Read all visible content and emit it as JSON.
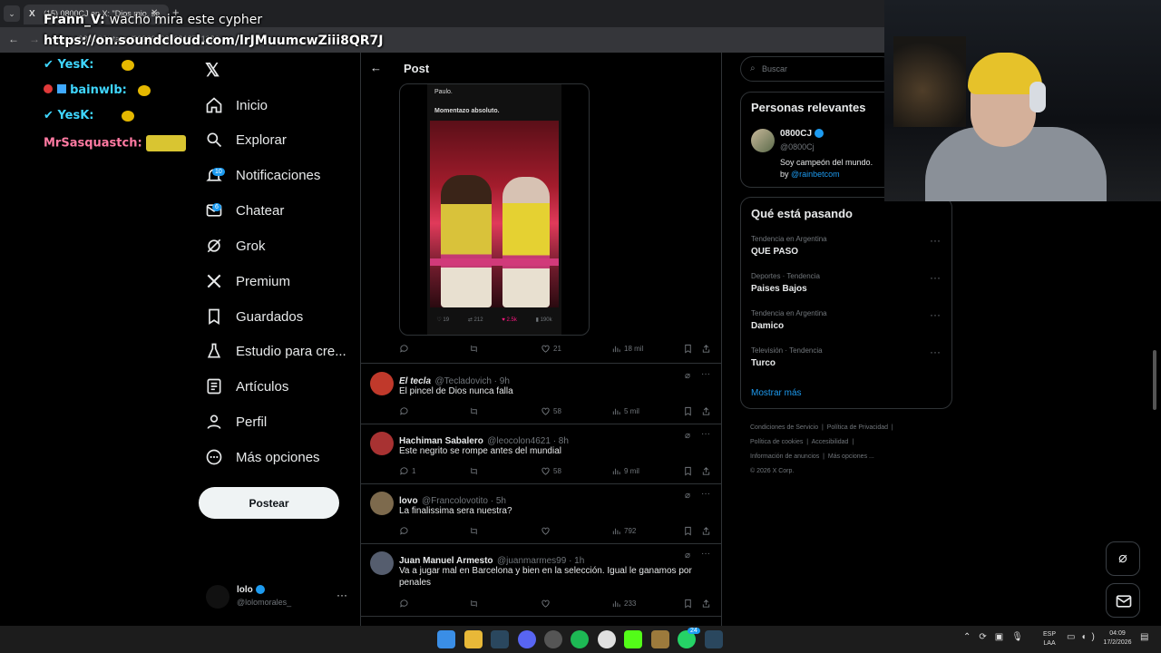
{
  "browser": {
    "tab_title": "(15) 0800CJ en X: \"Dios mio, se",
    "url": "x.com/0800CJ/status/2023612909918771286",
    "overlay_url": "https://on.soundcloud.com/lrJMuumcwZiii8QR7J"
  },
  "stream_chat": [
    {
      "user": "Frann_V:",
      "message": "wacho mira este cypher",
      "color": "#ffffff"
    },
    {
      "user": "YesK:",
      "message": "",
      "color": "#3fd6ff"
    },
    {
      "user": "bainwlb:",
      "message": "",
      "color": "#3fd6ff"
    },
    {
      "user": "YesK:",
      "message": "",
      "color": "#3fd6ff"
    },
    {
      "user": "MrSasquastch:",
      "message": "",
      "color": "#ff7aa2"
    }
  ],
  "nav": {
    "items": [
      {
        "label": "Inicio",
        "icon": "home-icon"
      },
      {
        "label": "Explorar",
        "icon": "search-icon"
      },
      {
        "label": "Notificaciones",
        "icon": "bell-icon",
        "badge": "10"
      },
      {
        "label": "Chatear",
        "icon": "mail-icon",
        "badge": "6"
      },
      {
        "label": "Grok",
        "icon": "grok-icon"
      },
      {
        "label": "Premium",
        "icon": "x-logo-icon"
      },
      {
        "label": "Guardados",
        "icon": "bookmark-icon"
      },
      {
        "label": "Estudio para cre...",
        "icon": "flask-icon"
      },
      {
        "label": "Artículos",
        "icon": "article-icon"
      },
      {
        "label": "Perfil",
        "icon": "person-icon"
      },
      {
        "label": "Más opciones",
        "icon": "more-circle-icon"
      }
    ],
    "post_label": "Postear",
    "account": {
      "name": "lolo",
      "handle": "@lolomorales_"
    }
  },
  "header": {
    "title": "Post"
  },
  "embedded": {
    "text_line1": "Paulo.",
    "text_line2": "Momentazo absoluto.",
    "stats": {
      "replies": "19",
      "reposts": "212",
      "likes": "2.5k",
      "views": "190k"
    }
  },
  "main_actions": {
    "likes": "21",
    "views": "18 mil"
  },
  "replies": [
    {
      "name": "El tecla",
      "handle": "@Tecladovich · 9h",
      "text": "El pincel de Dios nunca falla",
      "replies": "",
      "likes": "58",
      "views": "5 mil",
      "avatar_color": "#c0392b"
    },
    {
      "name": "Hachiman Sabalero",
      "handle": "@leocolon4621 · 8h",
      "text": "Este negrito se rompe antes del mundial",
      "replies": "1",
      "likes": "58",
      "views": "9 mil",
      "avatar_color": "#a83232"
    },
    {
      "name": "lovo",
      "handle": "@Francolovotito · 5h",
      "text": "La finalissima sera nuestra?",
      "replies": "",
      "likes": "",
      "views": "792",
      "avatar_color": "#7d6a4d"
    },
    {
      "name": "Juan Manuel Armesto",
      "handle": "@juanmarmes99 · 1h",
      "text": "Va a jugar mal en Barcelona y bien en la selección. Igual le ganamos por penales",
      "replies": "",
      "likes": "",
      "views": "233",
      "avatar_color": "#555d6e"
    }
  ],
  "right": {
    "search_placeholder": "Buscar",
    "relevant_title": "Personas relevantes",
    "relevant_user": {
      "name": "0800CJ",
      "handle": "@0800Cj",
      "bio": "Soy campeón del mundo.",
      "bio_by": "by ",
      "bio_link": "@rainbetcom"
    },
    "trends_title": "Qué está pasando",
    "trends": [
      {
        "meta": "Tendencia en Argentina",
        "name": "QUE PASO"
      },
      {
        "meta": "Deportes · Tendencia",
        "name": "Paises Bajos"
      },
      {
        "meta": "Tendencia en Argentina",
        "name": "Damico"
      },
      {
        "meta": "Televisión · Tendencia",
        "name": "Turco"
      }
    ],
    "show_more": "Mostrar más",
    "footer": [
      "Condiciones de Servicio",
      "Política de Privacidad",
      "Política de cookies",
      "Accesibilidad",
      "Información de anuncios",
      "Más opciones ...",
      "© 2026 X Corp."
    ]
  },
  "taskbar": {
    "lang1": "ESP",
    "lang2": "LAA",
    "time": "04:09",
    "date": "17/2/2026",
    "whatsapp_badge": "24"
  },
  "colors": {
    "accent": "#1d9bf0",
    "like": "#f91880",
    "bg": "#000000",
    "border": "#2f3336"
  }
}
